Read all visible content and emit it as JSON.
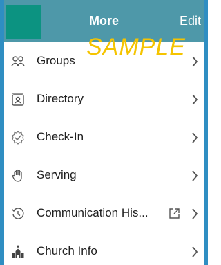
{
  "header": {
    "title": "More",
    "edit_label": "Edit"
  },
  "watermark": "SAMPLE",
  "items": [
    {
      "label": "Groups",
      "icon": "groups-icon"
    },
    {
      "label": "Directory",
      "icon": "directory-icon"
    },
    {
      "label": "Check-In",
      "icon": "check-in-icon"
    },
    {
      "label": "Serving",
      "icon": "serving-hand-icon"
    },
    {
      "label": "Communication His...",
      "icon": "history-icon",
      "external": true
    },
    {
      "label": "Church Info",
      "icon": "church-icon"
    }
  ],
  "colors": {
    "header_bg": "#4e98a9",
    "menu_block": "#0c9381",
    "frame": "#2f8ec2",
    "watermark": "#f5c400"
  }
}
